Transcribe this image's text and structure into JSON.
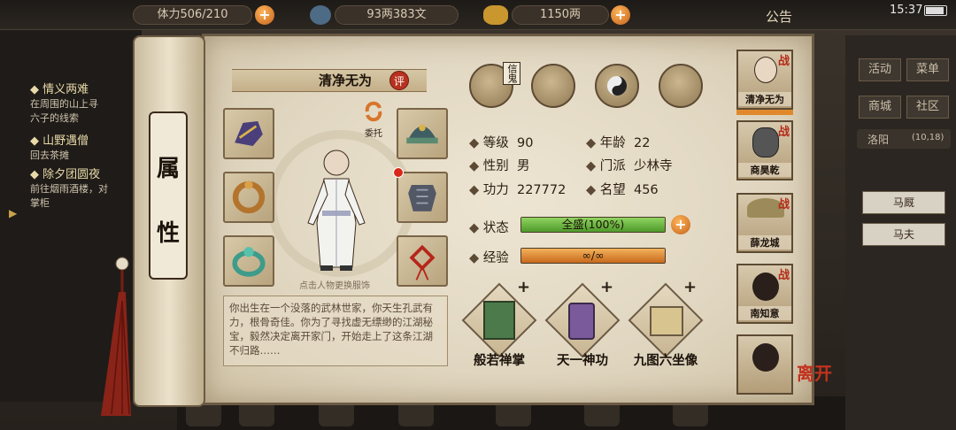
{
  "topbar": {
    "stamina": "体力506/210",
    "money": "93两383文",
    "gold": "1150两",
    "announce": "公告",
    "time": "15:37"
  },
  "quests": [
    {
      "title": "情义两难",
      "desc": "在周围的山上寻",
      "desc2": "六子的线索"
    },
    {
      "title": "山野遇僧",
      "desc": "回去茶摊",
      "desc2": ""
    },
    {
      "title": "除夕团圆夜",
      "desc": "前往烟雨酒楼，对",
      "desc2": "掌柜"
    }
  ],
  "scroll": {
    "title_top": "属",
    "title_bottom": "性"
  },
  "character": {
    "name": "清净无为",
    "ping": "评",
    "delegate": "委托",
    "change_hint": "点击人物更换服饰",
    "bio": "你出生在一个没落的武林世家，你天生孔武有力，根骨奇佳。你为了寻找虚无缥缈的江湖秘宝，毅然决定离开家门，开始走上了这条江湖不归路……",
    "icon_names": [
      "bag-icon",
      "map-icon",
      "bagua-icon",
      "body-meridian-icon"
    ],
    "icon_tag": "信鬼"
  },
  "stats": {
    "level_label": "等级",
    "level": "90",
    "age_label": "年龄",
    "age": "22",
    "gender_label": "性别",
    "gender": "男",
    "sect_label": "门派",
    "sect": "少林寺",
    "power_label": "功力",
    "power": "227772",
    "fame_label": "名望",
    "fame": "456",
    "status_label": "状态",
    "status_text": "全盛(100%)",
    "status_fraction": 1.0,
    "exp_label": "经验",
    "exp_text": "∞/∞",
    "exp_fraction": 1.0
  },
  "skills": [
    {
      "label": "般若禅掌"
    },
    {
      "label": "天一神功"
    },
    {
      "label": "九图六坐像"
    }
  ],
  "party": [
    {
      "name": "清净无为",
      "tag": "战"
    },
    {
      "name": "商昊乾",
      "tag": "战"
    },
    {
      "name": "薛龙城",
      "tag": "战"
    },
    {
      "name": "南知意",
      "tag": "战"
    },
    {
      "name": "",
      "tag": ""
    }
  ],
  "right_menu": {
    "activity": "活动",
    "menu": "菜单",
    "shop": "商城",
    "community": "社区",
    "location": "洛阳",
    "coords": "(10,18)",
    "stable": "马厩",
    "groom": "马夫"
  },
  "leave": "离开",
  "colors": {
    "status_bar": "#5fa837",
    "exp_bar": "#e0892c",
    "accent_red": "#b52a18"
  }
}
